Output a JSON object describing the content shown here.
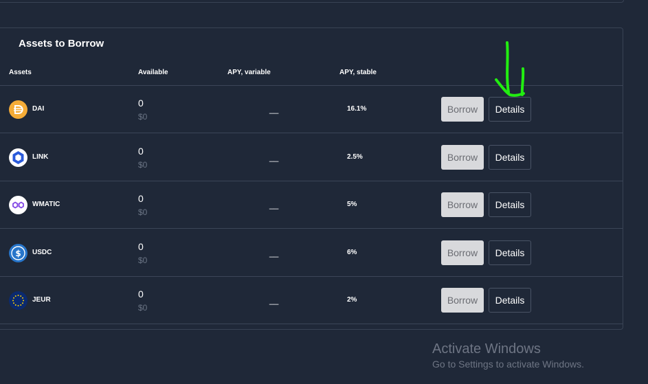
{
  "section_title": "Assets to Borrow",
  "columns": {
    "assets": "Assets",
    "available": "Available",
    "apy_variable": "APY, variable",
    "apy_stable": "APY, stable"
  },
  "rows": [
    {
      "asset": "DAI",
      "icon": "dai-icon",
      "available": "0",
      "available_usd": "$0",
      "apy_variable": "__",
      "apy_stable": "16.1%",
      "borrow_label": "Borrow",
      "details_label": "Details"
    },
    {
      "asset": "LINK",
      "icon": "link-icon",
      "available": "0",
      "available_usd": "$0",
      "apy_variable": "__",
      "apy_stable": "2.5%",
      "borrow_label": "Borrow",
      "details_label": "Details"
    },
    {
      "asset": "WMATIC",
      "icon": "wmatic-icon",
      "available": "0",
      "available_usd": "$0",
      "apy_variable": "__",
      "apy_stable": "5%",
      "borrow_label": "Borrow",
      "details_label": "Details"
    },
    {
      "asset": "USDC",
      "icon": "usdc-icon",
      "available": "0",
      "available_usd": "$0",
      "apy_variable": "__",
      "apy_stable": "6%",
      "borrow_label": "Borrow",
      "details_label": "Details"
    },
    {
      "asset": "JEUR",
      "icon": "jeur-icon",
      "available": "0",
      "available_usd": "$0",
      "apy_variable": "__",
      "apy_stable": "2%",
      "borrow_label": "Borrow",
      "details_label": "Details"
    }
  ],
  "watermark": {
    "title": "Activate Windows",
    "subtitle": "Go to Settings to activate Windows."
  },
  "colors": {
    "background": "#1f2838",
    "border": "#394354",
    "borrow_button": "#d8d9dc",
    "annotation": "#22ee11"
  }
}
